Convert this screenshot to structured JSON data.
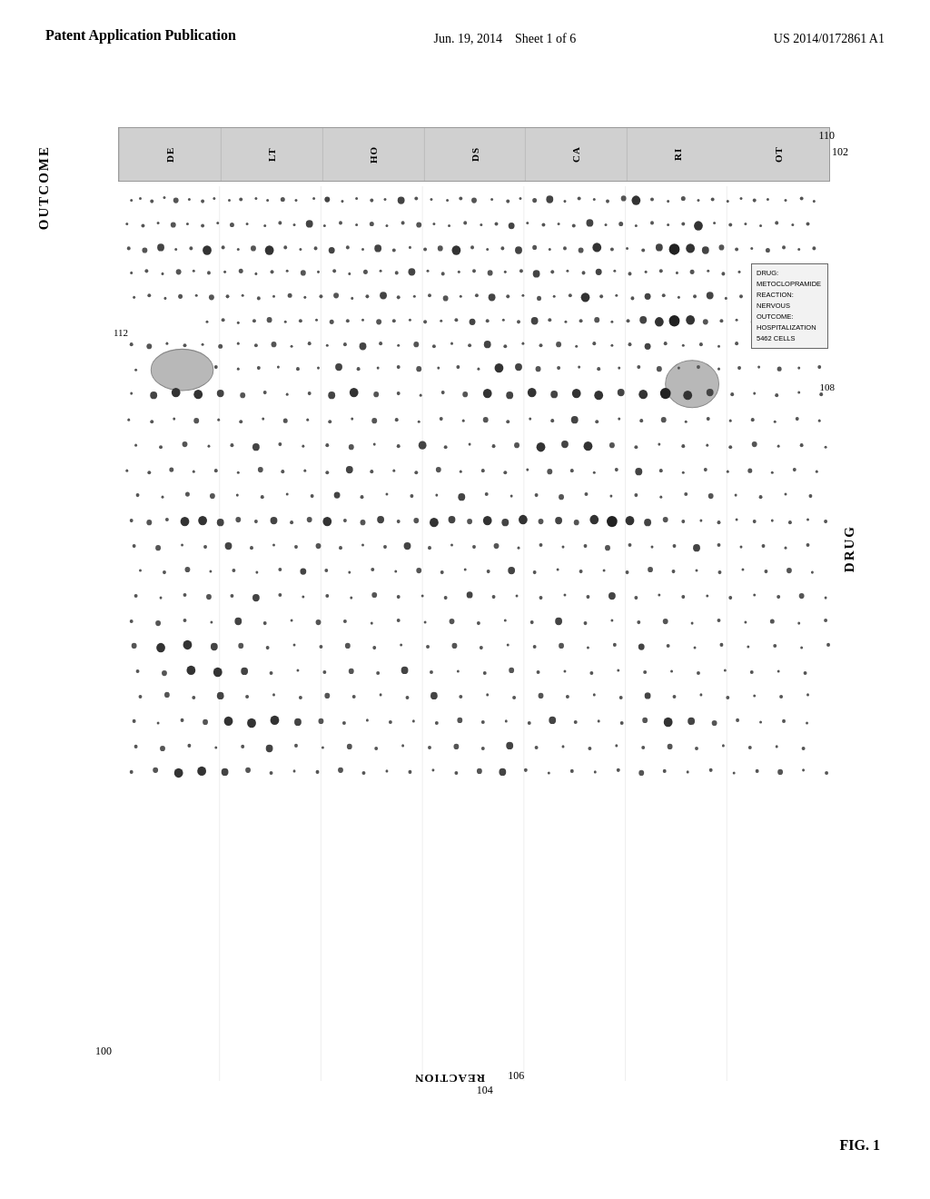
{
  "header": {
    "left_line1": "Patent Application Publication",
    "center_line1": "Jun. 19, 2014",
    "center_line2": "Sheet 1 of 6",
    "right_line1": "US 2014/0172861 A1"
  },
  "figure": {
    "label": "FIG. 1",
    "axis_labels": {
      "outcome": "OUTCOME",
      "drug": "DRUG",
      "reaction": "REACTION"
    },
    "col_headers": [
      "DE",
      "LT",
      "HO",
      "DS",
      "CA",
      "RI",
      "OT"
    ],
    "ref_numbers": {
      "main": "100",
      "col_area": "102",
      "drug_axis": "108",
      "reaction_col": "104",
      "ref106": "106",
      "ref110": "110",
      "ref112": "112"
    },
    "info_box": {
      "line1": "DRUG: METOCLOPRAMIDE",
      "line2": "REACTION: NERVOUS",
      "line3": "OUTCOME: HOSPITALIZATION",
      "line4": "5462 CELLS"
    }
  }
}
